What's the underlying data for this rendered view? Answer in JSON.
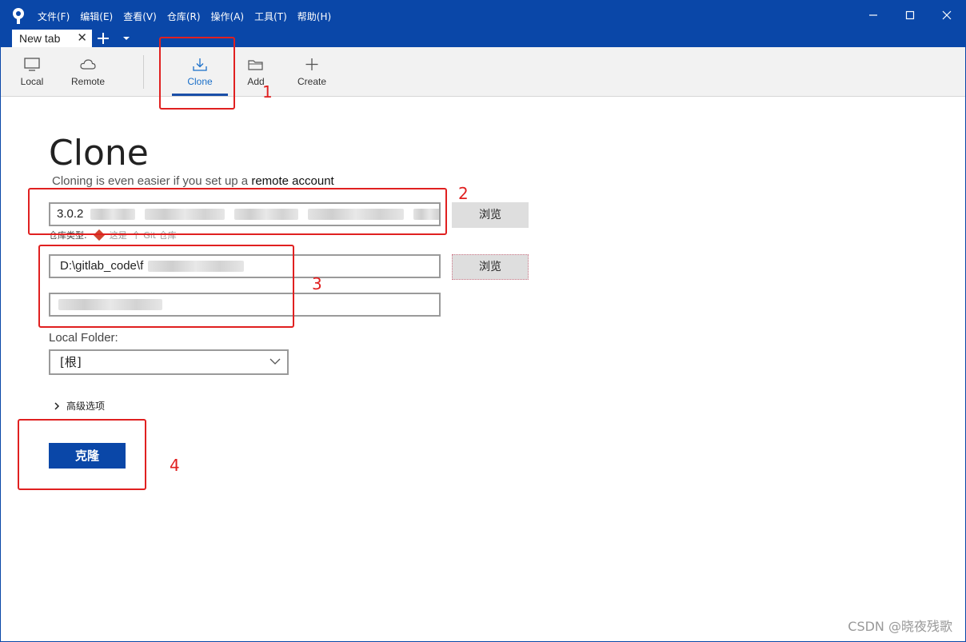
{
  "menu": [
    "文件(F)",
    "编辑(E)",
    "查看(V)",
    "仓库(R)",
    "操作(A)",
    "工具(T)",
    "帮助(H)"
  ],
  "tab": {
    "title": "New tab",
    "close": "✕",
    "add": "+"
  },
  "toolbar": {
    "items": [
      {
        "label": "Local",
        "icon": "monitor-icon"
      },
      {
        "label": "Remote",
        "icon": "cloud-icon"
      },
      {
        "label": "Clone",
        "icon": "download-icon"
      },
      {
        "label": "Add",
        "icon": "folder-icon"
      },
      {
        "label": "Create",
        "icon": "plus-icon"
      }
    ],
    "active": "Clone"
  },
  "clone": {
    "title": "Clone",
    "subtitle_prefix": "Cloning is even easier if you set up a",
    "subtitle_link": "remote account",
    "source_url_visible": "3.0.2",
    "browse_label": "浏览",
    "repo_type_label": "仓库类型:",
    "repo_type_value": "这是",
    "repo_type_git": "个 Git 仓库",
    "destination_visible": "D:\\gitlab_code\\f",
    "local_folder_label": "Local Folder:",
    "local_folder_value": "[根]",
    "advanced_label": "高级选项",
    "clone_button": "克隆"
  },
  "annotations": [
    "1",
    "2",
    "3",
    "4"
  ],
  "colors": {
    "brand": "#0a47a8",
    "annotation": "#e02020",
    "active_tab": "#1a6fc9"
  },
  "watermark": "CSDN @晓夜残歌"
}
